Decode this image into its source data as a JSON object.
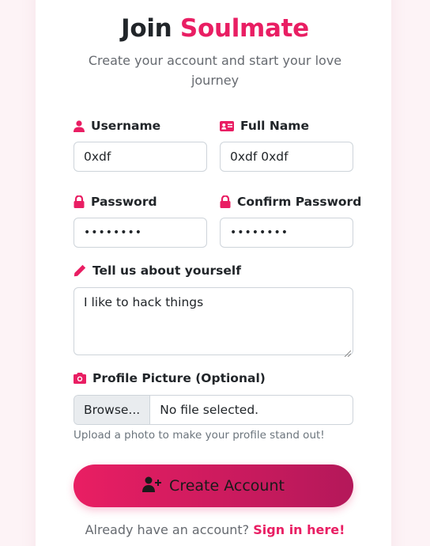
{
  "header": {
    "title_prefix": "Join",
    "title_brand": "Soulmate",
    "subtitle": "Create your account and start your love journey"
  },
  "form": {
    "username": {
      "label": "Username",
      "value": "0xdf",
      "icon": "user-icon"
    },
    "full_name": {
      "label": "Full Name",
      "value": "0xdf 0xdf",
      "icon": "id-card-icon"
    },
    "password": {
      "label": "Password",
      "value": "••••••••",
      "icon": "lock-icon"
    },
    "confirm_password": {
      "label": "Confirm Password",
      "value": "••••••••",
      "icon": "lock-icon"
    },
    "bio": {
      "label": "Tell us about yourself",
      "value": "I like to hack things",
      "icon": "pencil-icon"
    },
    "profile_picture": {
      "label": "Profile Picture (Optional)",
      "browse_label": "Browse...",
      "file_status": "No file selected.",
      "help": "Upload a photo to make your profile stand out!",
      "icon": "camera-icon"
    },
    "submit_label": "Create Account",
    "submit_icon": "user-plus-icon"
  },
  "footer": {
    "prompt": "Already have an account?",
    "link": "Sign in here!"
  },
  "colors": {
    "accent": "#e91e63",
    "accent_dark": "#b4185a",
    "background": "#fdf3f6"
  }
}
